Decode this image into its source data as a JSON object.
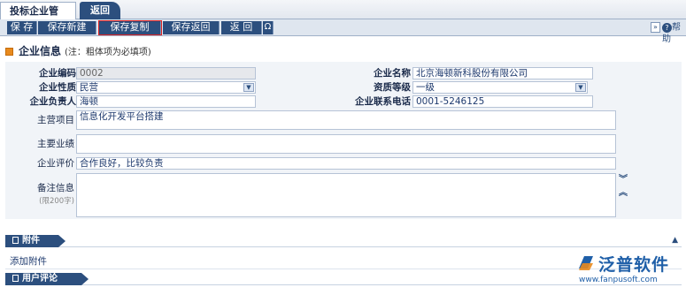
{
  "tabs": {
    "active": "投标企业管理",
    "other": "返回"
  },
  "toolbar": {
    "save": "保 存",
    "save_new": "保存新建",
    "save_copy": "保存复制",
    "save_return": "保存返回",
    "back": "返 回",
    "omega": "Ω",
    "nav_glyph": "»",
    "help_glyph": "?",
    "help": "帮助"
  },
  "section": {
    "title": "企业信息",
    "note": "(注：粗体项为必填项)"
  },
  "form": {
    "code_label": "企业编码",
    "code_value": "0002",
    "name_label": "企业名称",
    "name_value": "北京海顿新科股份有限公司",
    "nature_label": "企业性质",
    "nature_value": "民营",
    "grade_label": "资质等级",
    "grade_value": "一级",
    "leader_label": "企业负责人",
    "leader_value": "海顿",
    "phone_label": "企业联系电话",
    "phone_value": "0001-5246125",
    "main_project_label": "主营项目",
    "main_project_value": "信息化开发平台搭建",
    "performance_label": "主要业绩",
    "performance_value": "",
    "evaluation_label": "企业评价",
    "evaluation_value": "合作良好，比较负责",
    "remark_label": "备注信息",
    "remark_limit": "(限200字)",
    "remark_value": ""
  },
  "bars": {
    "attachments": "附件",
    "comments": "用户评论"
  },
  "attachments": {
    "add_link": "添加附件"
  },
  "brand": {
    "name": "泛普软件",
    "url": "www.fanpusoft.com"
  },
  "colors": {
    "accent": "#2c4f7e",
    "highlight": "#dd2222",
    "section_mark": "#e88a1e",
    "brand": "#1f5fa8"
  }
}
